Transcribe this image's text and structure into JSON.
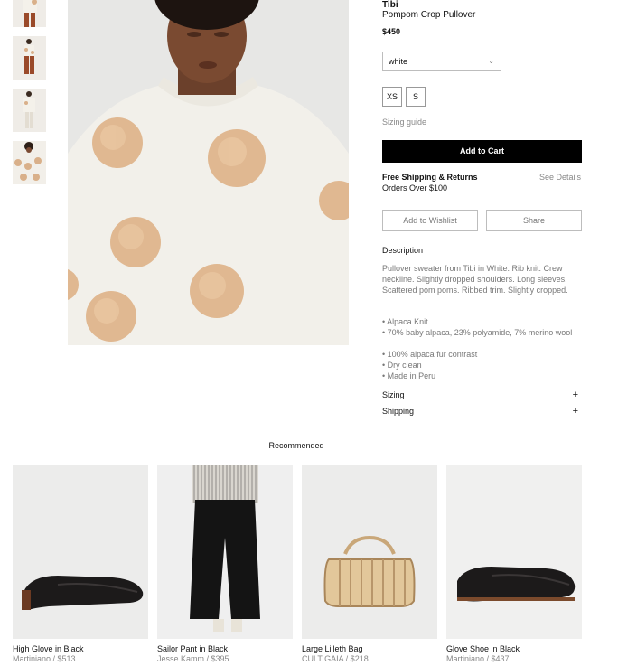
{
  "product": {
    "brand": "Tibi",
    "name": "Pompom Crop Pullover",
    "price": "$450",
    "color_value": "white",
    "sizes": [
      "XS",
      "S"
    ],
    "sizing_guide": "Sizing guide",
    "add_to_cart": "Add to Cart",
    "shipping_title": "Free Shipping & Returns",
    "shipping_sub": "Orders Over $100",
    "see_details": "See Details",
    "wishlist": "Add to Wishlist",
    "share": "Share",
    "description_heading": "Description",
    "description": "Pullover sweater from Tibi in White. Rib knit. Crew neckline. Slightly dropped shoulders. Long sleeves. Scattered pom poms. Ribbed trim. Slightly cropped.",
    "bullets": [
      "• Alpaca Knit",
      "• 70% baby alpaca, 23% polyamide, 7% merino wool",
      "• 100% alpaca fur contrast",
      "• Dry clean",
      "• Made in Peru"
    ],
    "accordions": [
      {
        "label": "Sizing",
        "icon": "+"
      },
      {
        "label": "Shipping",
        "icon": "+"
      }
    ]
  },
  "recommended": {
    "heading": "Recommended",
    "items": [
      {
        "title": "High Glove in Black",
        "sub": "Martiniano / $513"
      },
      {
        "title": "Sailor Pant in Black",
        "sub": "Jesse Kamm / $395"
      },
      {
        "title": "Large Lilleth Bag",
        "sub": "CULT GAIA / $218"
      },
      {
        "title": "Glove Shoe in Black",
        "sub": "Martiniano / $437"
      }
    ]
  },
  "colors": {
    "accent": "#000000",
    "muted": "#888888",
    "border": "#bdbdbd"
  },
  "icons": {
    "select": "chevron-down-icon",
    "accordion": "plus-icon"
  }
}
